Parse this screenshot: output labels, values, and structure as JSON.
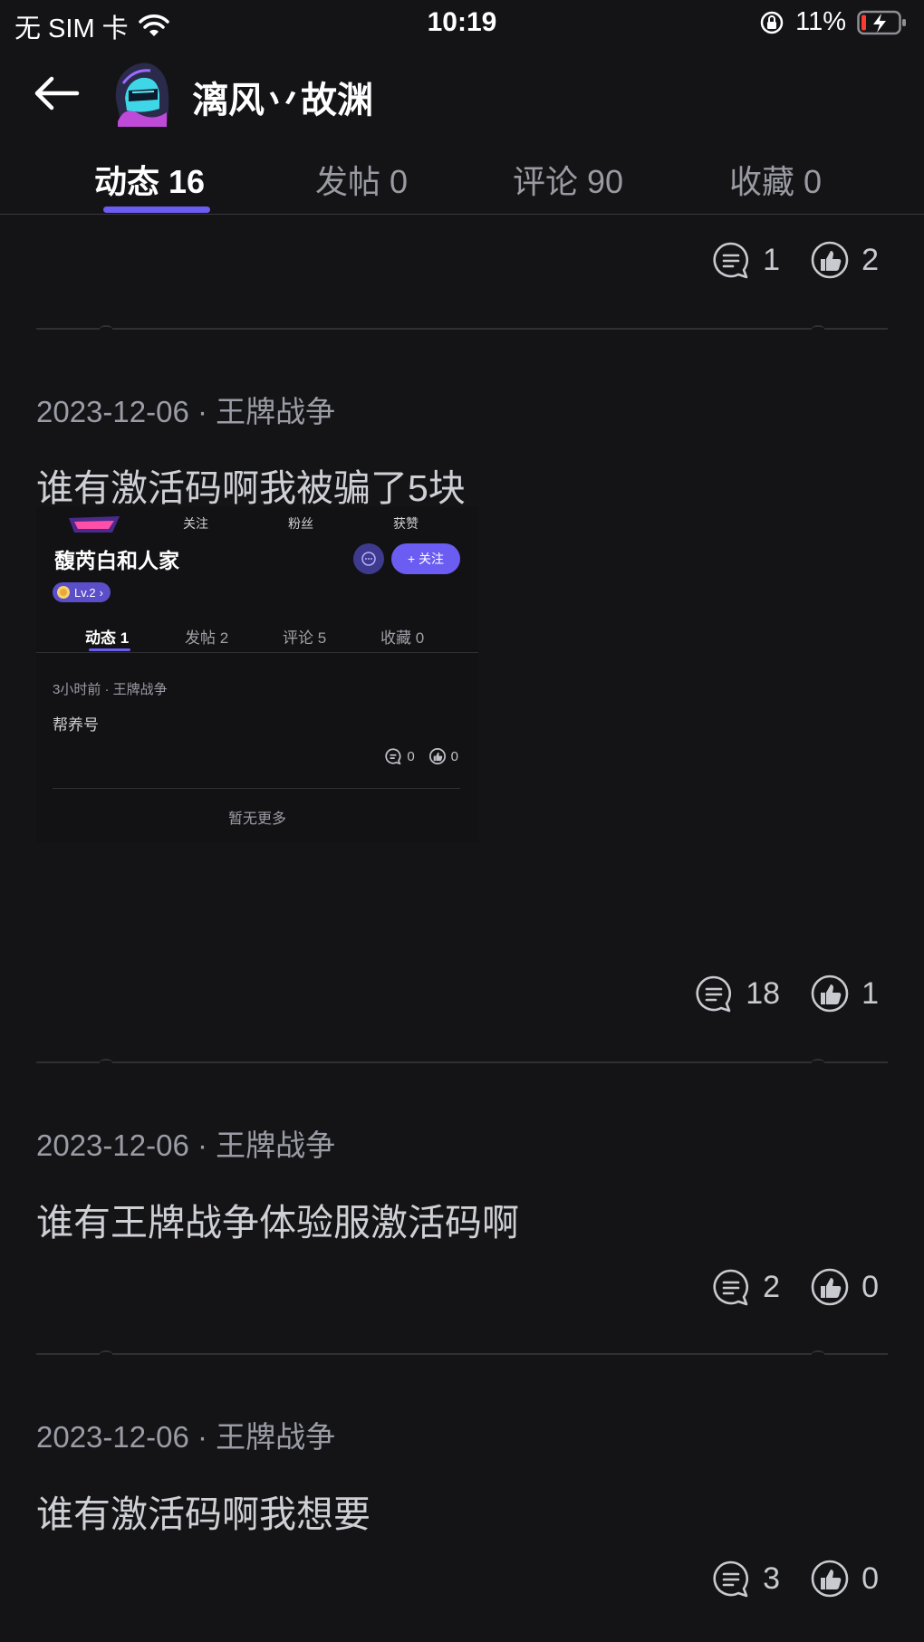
{
  "status_bar": {
    "carrier": "无 SIM 卡",
    "time": "10:19",
    "battery": "11%",
    "icons": [
      "wifi-icon",
      "orientation-lock-icon",
      "battery-charging-icon"
    ]
  },
  "header": {
    "username": "漓风丷故渊",
    "back_icon": "arrow-left-icon"
  },
  "tabs": [
    {
      "label": "动态 16",
      "active": true
    },
    {
      "label": "发帖 0",
      "active": false
    },
    {
      "label": "评论 90",
      "active": false
    },
    {
      "label": "收藏 0",
      "active": false
    }
  ],
  "first_actions": {
    "comments": "1",
    "likes": "2"
  },
  "posts": [
    {
      "meta": "2023-12-06 · 王牌战争",
      "text": "谁有激活码啊我被骗了5块",
      "comments": "18",
      "likes": "1",
      "embedded_screenshot": {
        "stats": [
          "关注",
          "粉丝",
          "获赞"
        ],
        "name": "馥芮白和人家",
        "level": "Lv.2",
        "follow_label": "+ 关注",
        "tabs": [
          "动态 1",
          "发帖 2",
          "评论 5",
          "收藏 0"
        ],
        "meta": "3小时前 · 王牌战争",
        "post": "帮养号",
        "comments": "0",
        "likes": "0",
        "no_more": "暂无更多"
      }
    },
    {
      "meta": "2023-12-06 · 王牌战争",
      "text": "谁有王牌战争体验服激活码啊",
      "comments": "2",
      "likes": "0"
    },
    {
      "meta": "2023-12-06 · 王牌战争",
      "text": "谁有激活码啊我想要",
      "comments": "3",
      "likes": "0"
    }
  ],
  "colors": {
    "background": "#141416",
    "accent": "#6b5cf2",
    "muted_text": "#9b9ca6"
  }
}
